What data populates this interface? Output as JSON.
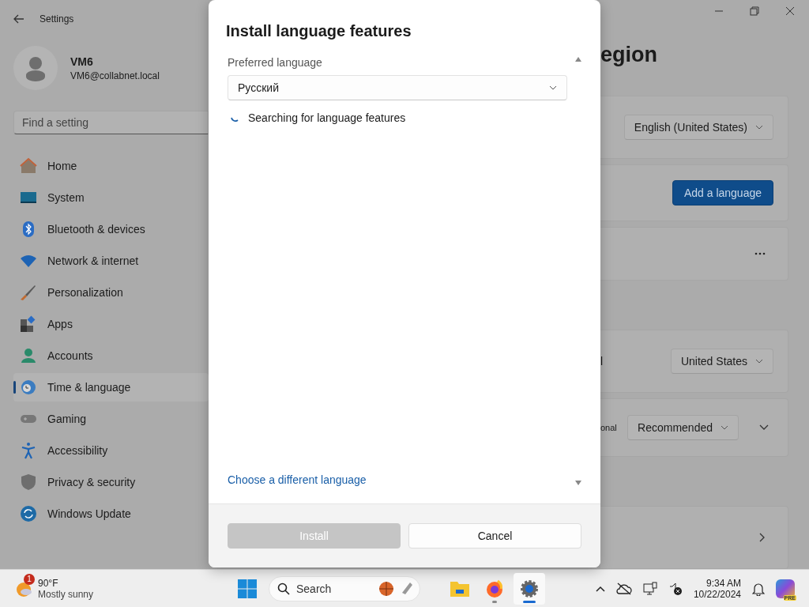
{
  "window": {
    "title": "Settings"
  },
  "account": {
    "name": "VM6",
    "email": "VM6@collabnet.local"
  },
  "search": {
    "placeholder": "Find a setting"
  },
  "nav": [
    {
      "label": "Home",
      "kind": "home",
      "selected": false
    },
    {
      "label": "System",
      "kind": "system",
      "selected": false
    },
    {
      "label": "Bluetooth & devices",
      "kind": "bluetooth",
      "selected": false
    },
    {
      "label": "Network & internet",
      "kind": "network",
      "selected": false
    },
    {
      "label": "Personalization",
      "kind": "brush",
      "selected": false
    },
    {
      "label": "Apps",
      "kind": "apps",
      "selected": false
    },
    {
      "label": "Accounts",
      "kind": "accounts",
      "selected": false
    },
    {
      "label": "Time & language",
      "kind": "time",
      "selected": true
    },
    {
      "label": "Gaming",
      "kind": "gaming",
      "selected": false
    },
    {
      "label": "Accessibility",
      "kind": "accessibility",
      "selected": false
    },
    {
      "label": "Privacy & security",
      "kind": "privacy",
      "selected": false
    },
    {
      "label": "Windows Update",
      "kind": "update",
      "selected": false
    }
  ],
  "page": {
    "heading": "egion",
    "sections": [
      {
        "cards": [
          {
            "kind": "dropdown",
            "value": "English (United States)"
          },
          {
            "kind": "button",
            "label": "Add a language"
          },
          {
            "kind": "more"
          }
        ]
      },
      {
        "cards": [
          {
            "kind": "dropdown",
            "fragment": "l",
            "value": "United States"
          },
          {
            "kind": "dropdown_expand",
            "fragment": "onal",
            "value": "Recommended"
          }
        ]
      },
      {
        "cards": [
          {
            "kind": "link"
          }
        ]
      }
    ]
  },
  "dialog": {
    "title": "Install language features",
    "field_label": "Preferred language",
    "selected_language": "Русский",
    "status": "Searching for language features",
    "link": "Choose a different language",
    "buttons": [
      {
        "label": "Install",
        "disabled": true
      },
      {
        "label": "Cancel",
        "disabled": false
      }
    ]
  },
  "taskbar": {
    "weather": {
      "badge": "1",
      "temperature": "90°F",
      "condition": "Mostly sunny"
    },
    "search_placeholder": "Search",
    "apps": [
      {
        "kind": "explorer",
        "running": false,
        "active": false
      },
      {
        "kind": "firefox",
        "running": true,
        "active": false
      },
      {
        "kind": "settings",
        "running": true,
        "active": true
      }
    ],
    "time": "9:34 AM",
    "date": "10/22/2024",
    "copilot_badge": "PRE"
  }
}
